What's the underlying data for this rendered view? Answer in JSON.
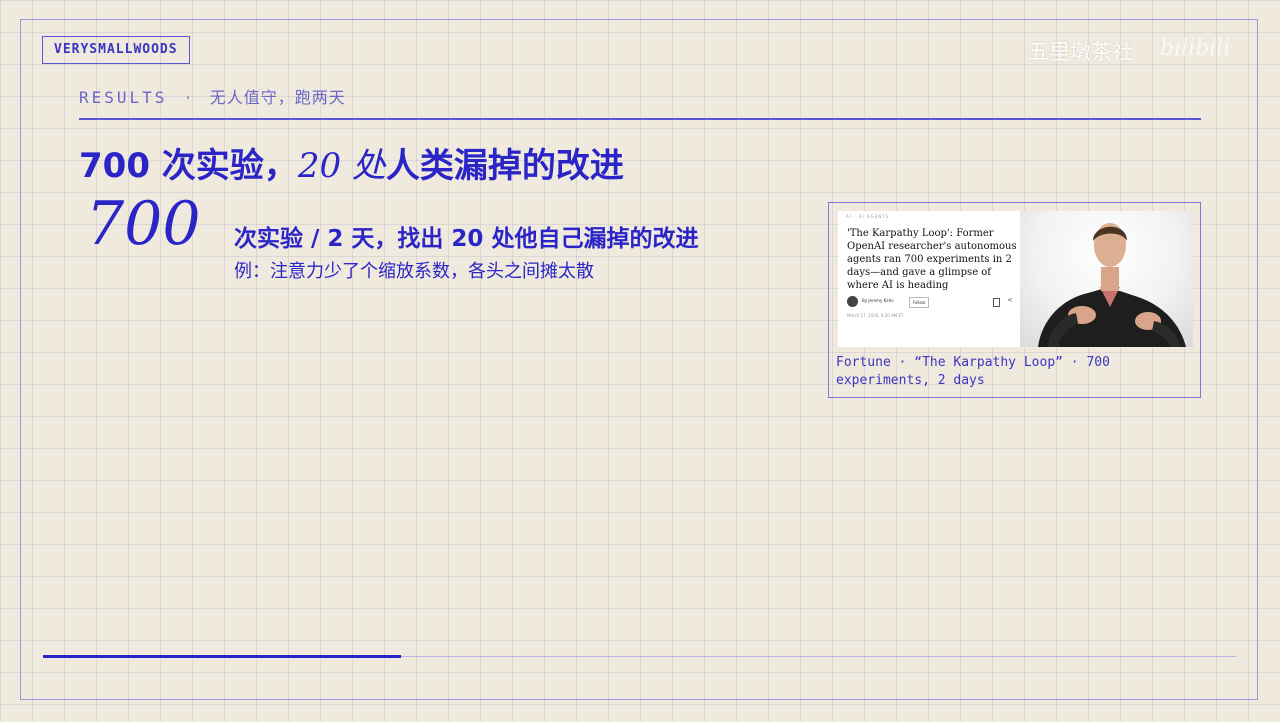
{
  "brand": "VERYSMALLWOODS",
  "watermark": {
    "text": "五里墩茶社",
    "logo_text": "bilibili"
  },
  "section": {
    "label": "RESULTS",
    "separator": "·",
    "subtitle": "无人值守，跑两天"
  },
  "headline": {
    "part1": "700 次实验，",
    "part2": "20 处",
    "part3": "人类漏掉的改进"
  },
  "stat": {
    "number": "700",
    "line1": "次实验 / 2 天，找出 20 处他自己漏掉的改进",
    "line2": "例：注意力少了个缩放系数，各头之间摊太散"
  },
  "article": {
    "kicker": "AI · AI AGENTS",
    "title": "'The Karpathy Loop': Former OpenAI researcher's autonomous agents ran 700 experiments in 2 days—and gave a glimpse of where AI is heading",
    "author": "By Jeremy Kahn",
    "follow": "Follow",
    "date": "March 17, 2026, 6:20 AM ET",
    "share_icon": "share-icon",
    "save_icon": "bookmark-icon"
  },
  "caption": "Fortune · “The Karpathy Loop” · 700 experiments, 2 days",
  "progress": {
    "fraction": 0.3,
    "color": "#2b25c8"
  },
  "colors": {
    "accent": "#2b25c8",
    "frame": "#9a97e0",
    "background": "#efeadd"
  }
}
